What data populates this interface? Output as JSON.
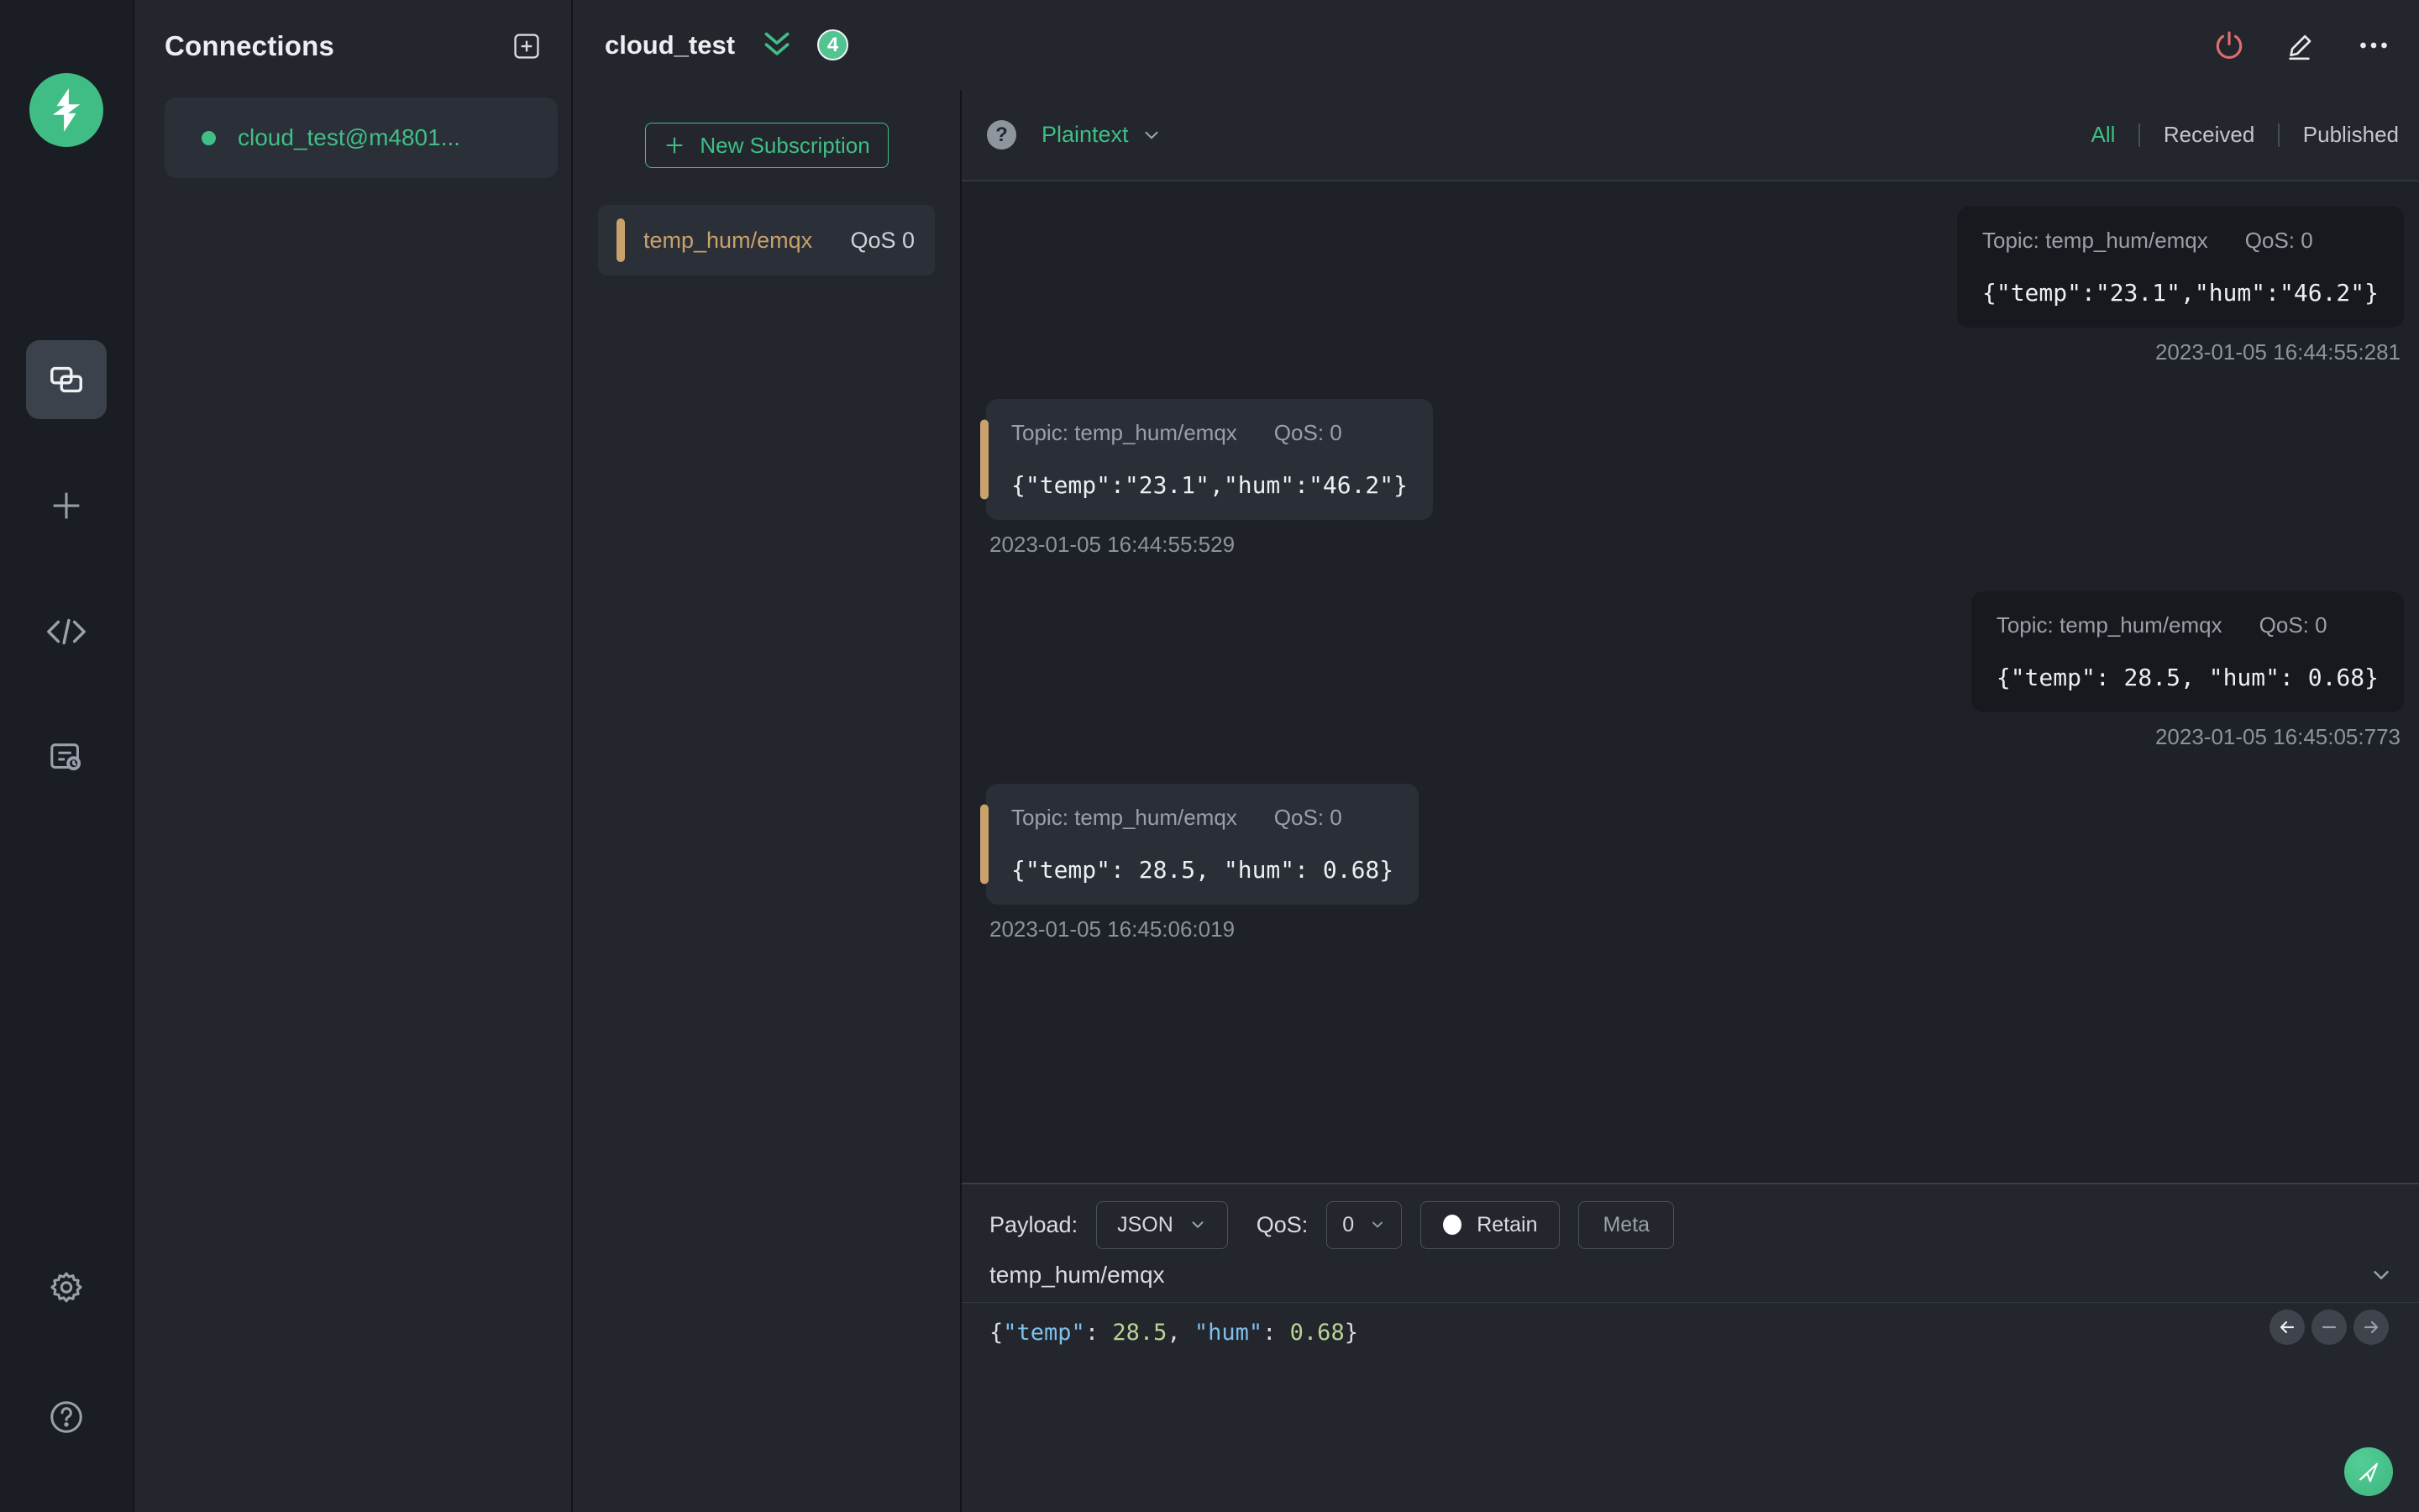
{
  "colors": {
    "accent_green": "#3fbf86",
    "badge_green": "#52c492",
    "topic_orange": "#c9a16b",
    "disconnect_red": "#e26d6d",
    "panel_bg": "#23262d",
    "list_bg": "#1e2128",
    "received_card_bg": "#2a2e36",
    "published_card_bg": "#17191f",
    "json_key_blue": "#7fc0ea",
    "json_number_green": "#b9d393"
  },
  "rail": {
    "logo": "mqttx-logo",
    "items": [
      {
        "name": "connections",
        "icon": "overlapping-windows-icon",
        "active": true
      },
      {
        "name": "new-connection",
        "icon": "plus-icon",
        "active": false
      },
      {
        "name": "script",
        "icon": "code-icon",
        "active": false
      },
      {
        "name": "log",
        "icon": "log-icon",
        "active": false
      }
    ],
    "bottom_items": [
      {
        "name": "settings",
        "icon": "gear-icon"
      },
      {
        "name": "help",
        "icon": "help-icon"
      }
    ]
  },
  "connections_panel": {
    "title": "Connections",
    "add_button": "new-connection",
    "items": [
      {
        "name": "cloud_test@m4801...",
        "status_color": "#3fbf86"
      }
    ]
  },
  "header": {
    "title": "cloud_test",
    "unread_count": "4"
  },
  "subscriptions": {
    "new_button_label": "New Subscription",
    "items": [
      {
        "topic": "temp_hum/emqx",
        "qos": "QoS 0"
      }
    ]
  },
  "msg_toolbar": {
    "format_selected": "Plaintext",
    "filters": [
      {
        "label": "All",
        "active": true
      },
      {
        "label": "Received",
        "active": false
      },
      {
        "label": "Published",
        "active": false
      }
    ]
  },
  "messages_meta": {
    "topic_prefix": "Topic:",
    "qos_prefix": "QoS:"
  },
  "messages": [
    {
      "direction": "publish",
      "topic": "temp_hum/emqx",
      "qos": "0",
      "payload": "{\"temp\":\"23.1\",\"hum\":\"46.2\"}",
      "timestamp": "2023-01-05 16:44:55:281"
    },
    {
      "direction": "receive",
      "topic": "temp_hum/emqx",
      "qos": "0",
      "payload": "{\"temp\":\"23.1\",\"hum\":\"46.2\"}",
      "timestamp": "2023-01-05 16:44:55:529"
    },
    {
      "direction": "publish",
      "topic": "temp_hum/emqx",
      "qos": "0",
      "payload": "{\"temp\": 28.5, \"hum\": 0.68}",
      "timestamp": "2023-01-05 16:45:05:773"
    },
    {
      "direction": "receive",
      "topic": "temp_hum/emqx",
      "qos": "0",
      "payload": "{\"temp\": 28.5, \"hum\": 0.68}",
      "timestamp": "2023-01-05 16:45:06:019"
    }
  ],
  "publish": {
    "payload_label": "Payload:",
    "payload_format": "JSON",
    "qos_label": "QoS:",
    "qos_value": "0",
    "retain_label": "Retain",
    "meta_label": "Meta",
    "topic_value": "temp_hum/emqx",
    "editor_payload": "{\"temp\": 28.5, \"hum\": 0.68}"
  }
}
